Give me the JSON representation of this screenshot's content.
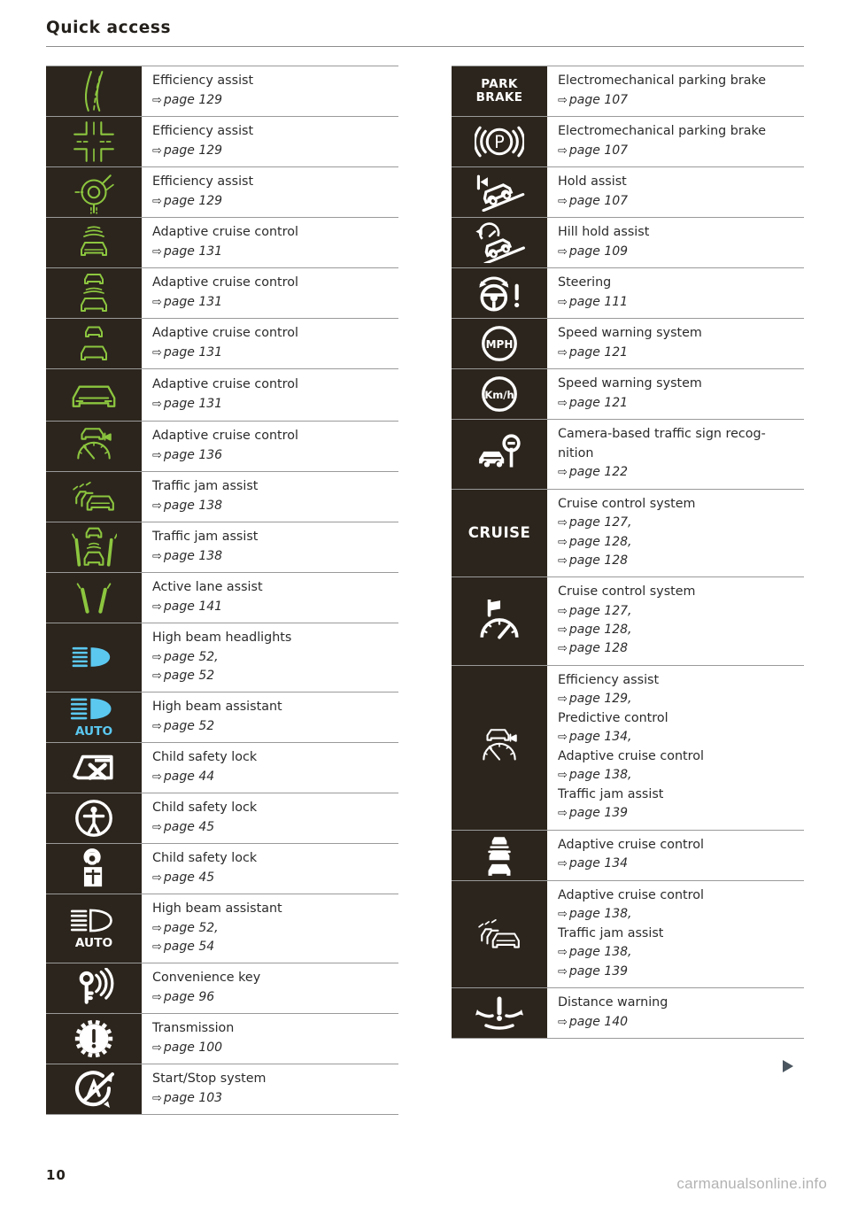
{
  "page": {
    "title": "Quick access",
    "folio": "10",
    "watermark": "carmanualsonline.info",
    "next_page_arrow": "▶"
  },
  "colors": {
    "icon_cell_background": "#2c251d",
    "green_icon": "#8cc63f",
    "blue_icon": "#5bc8f0",
    "white_icon": "#ffffff",
    "text": "#2b2b2b",
    "rule": "#9a9a9a"
  },
  "left_column": [
    {
      "icon": "lane-departure-road-icon",
      "icon_color": "green",
      "title": "Efficiency assist",
      "refs": [
        "page 129"
      ]
    },
    {
      "icon": "intersection-junction-icon",
      "icon_color": "green",
      "title": "Efficiency assist",
      "refs": [
        "page 129"
      ]
    },
    {
      "icon": "roundabout-icon",
      "icon_color": "green",
      "title": "Efficiency assist",
      "refs": [
        "page 129"
      ]
    },
    {
      "icon": "car-front-with-waves-icon",
      "icon_color": "green",
      "title": "Adaptive cruise control",
      "refs": [
        "page 131"
      ]
    },
    {
      "icon": "two-cars-distance-waves-icon",
      "icon_color": "green",
      "title": "Adaptive cruise control",
      "refs": [
        "page 131"
      ]
    },
    {
      "icon": "two-cars-far-distance-icon",
      "icon_color": "green",
      "title": "Adaptive cruise control",
      "refs": [
        "page 131"
      ]
    },
    {
      "icon": "car-front-solid-icon",
      "icon_color": "green",
      "title": "Adaptive cruise control",
      "refs": [
        "page 131"
      ]
    },
    {
      "icon": "car-with-speedometer-icon",
      "icon_color": "green",
      "title": "Adaptive cruise control",
      "refs": [
        "page 136"
      ]
    },
    {
      "icon": "traffic-jam-cars-icon",
      "icon_color": "green",
      "title": "Traffic jam assist",
      "refs": [
        "page 138"
      ]
    },
    {
      "icon": "car-between-lane-markings-icon",
      "icon_color": "green",
      "title": "Traffic jam assist",
      "refs": [
        "page 138"
      ]
    },
    {
      "icon": "lane-markings-icon",
      "icon_color": "green",
      "title": "Active lane assist",
      "refs": [
        "page 141"
      ]
    },
    {
      "icon": "high-beam-headlight-icon",
      "icon_color": "blue",
      "title": "High beam headlights",
      "refs": [
        "page 52,",
        "page 52"
      ]
    },
    {
      "icon": "high-beam-auto-icon",
      "icon_color": "blue",
      "title": "High beam assistant",
      "refs": [
        "page 52"
      ]
    },
    {
      "icon": "child-safety-lock-window-icon",
      "icon_color": "white",
      "title": "Child safety lock",
      "refs": [
        "page 44"
      ]
    },
    {
      "icon": "child-safety-lock-person-icon",
      "icon_color": "white",
      "title": "Child safety lock",
      "refs": [
        "page 45"
      ]
    },
    {
      "icon": "child-safety-lock-seat-icon",
      "icon_color": "white",
      "title": "Child safety lock",
      "refs": [
        "page 45"
      ]
    },
    {
      "icon": "high-beam-auto-white-icon",
      "icon_color": "white",
      "title": "High beam assistant",
      "refs": [
        "page 52,",
        "page 54"
      ]
    },
    {
      "icon": "convenience-key-icon",
      "icon_color": "white",
      "title": "Convenience key",
      "refs": [
        "page 96"
      ]
    },
    {
      "icon": "gear-exclamation-icon",
      "icon_color": "white",
      "title": "Transmission",
      "refs": [
        "page 100"
      ]
    },
    {
      "icon": "start-stop-system-icon",
      "icon_color": "white",
      "title": "Start/Stop system",
      "refs": [
        "page 103"
      ]
    }
  ],
  "right_column": [
    {
      "icon": "park-brake-text-icon",
      "icon_color": "white",
      "title": "Electromechanical parking brake",
      "refs": [
        "page 107"
      ]
    },
    {
      "icon": "parking-brake-p-circle-icon",
      "icon_color": "white",
      "title": "Electromechanical parking brake",
      "refs": [
        "page 107"
      ]
    },
    {
      "icon": "hold-assist-icon",
      "icon_color": "white",
      "title": "Hold assist",
      "refs": [
        "page 107"
      ]
    },
    {
      "icon": "hill-hold-assist-icon",
      "icon_color": "white",
      "title": "Hill hold assist",
      "refs": [
        "page 109"
      ]
    },
    {
      "icon": "steering-wheel-warning-icon",
      "icon_color": "white",
      "title": "Steering",
      "refs": [
        "page 111"
      ]
    },
    {
      "icon": "mph-circle-icon",
      "icon_color": "white",
      "title": "Speed warning system",
      "refs": [
        "page 121"
      ]
    },
    {
      "icon": "kmh-circle-icon",
      "icon_color": "white",
      "title": "Speed warning system",
      "refs": [
        "page 121"
      ]
    },
    {
      "icon": "car-traffic-sign-icon",
      "icon_color": "white",
      "title": "Camera-based traffic sign recog-\nnition",
      "refs": [
        "page 122"
      ]
    },
    {
      "icon": "cruise-text-icon",
      "icon_color": "white",
      "title": "Cruise control system",
      "refs": [
        "page 127,",
        "page 128,",
        "page 128"
      ]
    },
    {
      "icon": "speedometer-flag-icon",
      "icon_color": "white",
      "title": "Cruise control system",
      "refs": [
        "page 127,",
        "page 128,",
        "page 128"
      ]
    },
    {
      "icon": "car-speedometer-white-icon",
      "icon_color": "white",
      "multi": [
        {
          "title": "Efficiency assist",
          "refs": [
            "page 129,"
          ]
        },
        {
          "title": "Predictive control",
          "refs": [
            "page 134,"
          ]
        },
        {
          "title": "Adaptive cruise control",
          "refs": [
            "page 138,"
          ]
        },
        {
          "title": "Traffic jam assist",
          "refs": [
            "page 139"
          ]
        }
      ]
    },
    {
      "icon": "two-cars-stacked-white-icon",
      "icon_color": "white",
      "title": "Adaptive cruise control",
      "refs": [
        "page 134"
      ]
    },
    {
      "icon": "traffic-jam-cars-white-icon",
      "icon_color": "white",
      "multi": [
        {
          "title": "Adaptive cruise control",
          "refs": [
            "page 138,"
          ]
        },
        {
          "title": "Traffic jam assist",
          "refs": [
            "page 138,",
            "page 139"
          ]
        }
      ]
    },
    {
      "icon": "distance-warning-icon",
      "icon_color": "white",
      "title": "Distance warning",
      "refs": [
        "page 140"
      ]
    }
  ]
}
